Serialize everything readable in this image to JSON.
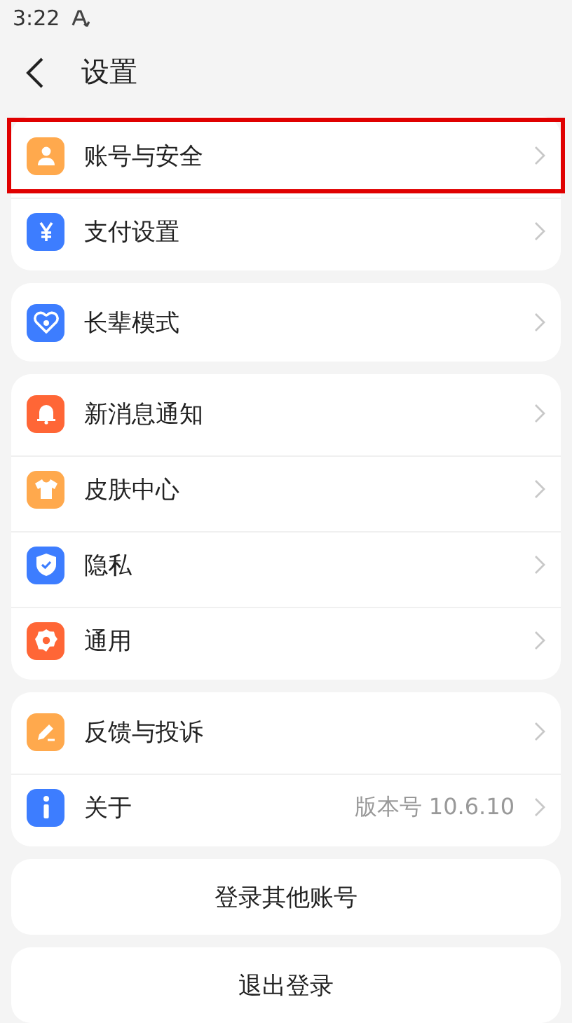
{
  "status_bar": {
    "time": "3:22"
  },
  "header": {
    "title": "设置"
  },
  "groups": [
    {
      "items": [
        {
          "label": "账号与安全",
          "kind": "person",
          "color": "#ffa94d",
          "highlighted": true
        },
        {
          "label": "支付设置",
          "kind": "yen",
          "color": "#3d7dff",
          "highlighted": false
        }
      ]
    },
    {
      "items": [
        {
          "label": "长辈模式",
          "kind": "heart",
          "color": "#3d7dff",
          "highlighted": false
        }
      ]
    },
    {
      "items": [
        {
          "label": "新消息通知",
          "kind": "bell",
          "color": "#ff6636",
          "highlighted": false
        },
        {
          "label": "皮肤中心",
          "kind": "shirt",
          "color": "#ffa94d",
          "highlighted": false
        },
        {
          "label": "隐私",
          "kind": "shield",
          "color": "#3d7dff",
          "highlighted": false
        },
        {
          "label": "通用",
          "kind": "gear",
          "color": "#ff6636",
          "highlighted": false
        }
      ]
    },
    {
      "items": [
        {
          "label": "反馈与投诉",
          "kind": "pen",
          "color": "#ffa94d",
          "highlighted": false
        },
        {
          "label": "关于",
          "kind": "info",
          "color": "#3d7dff",
          "highlighted": false,
          "value": "版本号 10.6.10"
        }
      ]
    }
  ],
  "buttons": [
    "登录其他账号",
    "退出登录"
  ]
}
